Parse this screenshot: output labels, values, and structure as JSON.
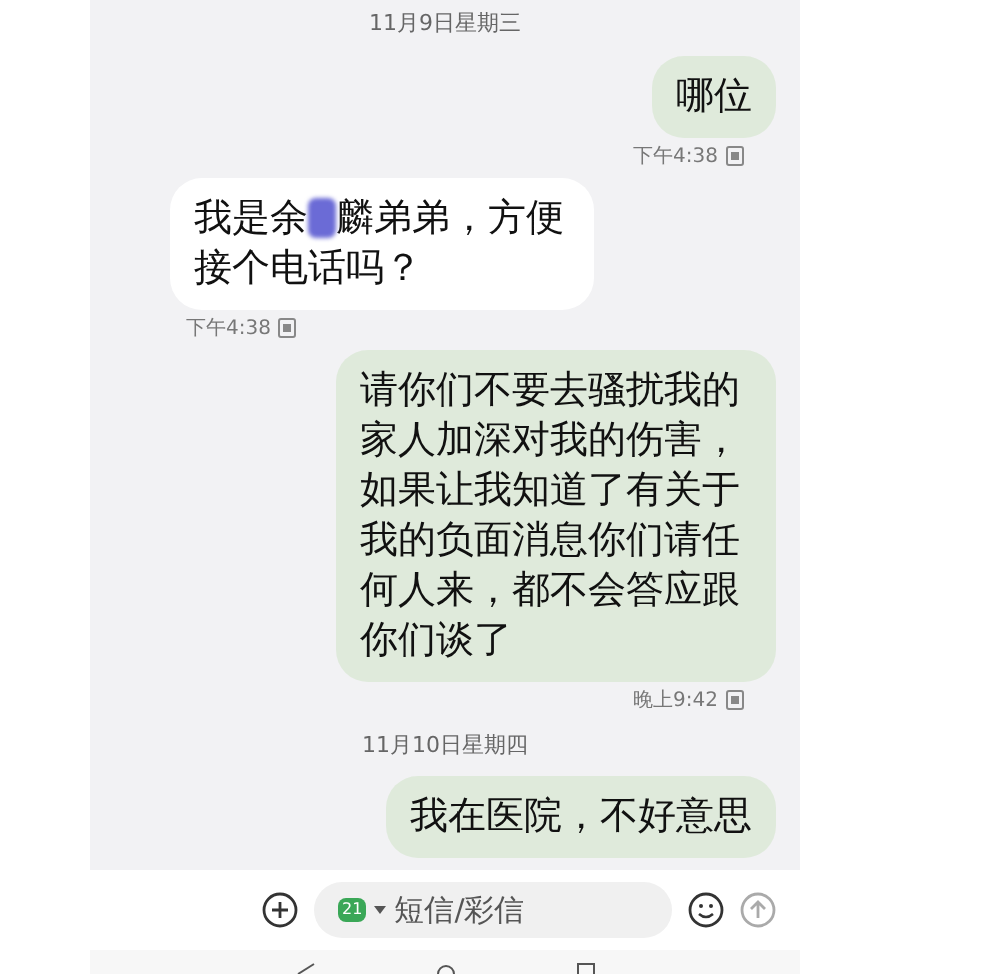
{
  "messages": [
    {
      "kind": "date",
      "text": "11月9日星期三"
    },
    {
      "kind": "out",
      "text": "哪位",
      "time": "下午4:38"
    },
    {
      "kind": "in",
      "text_before": "我是余",
      "redacted": true,
      "text_after": "麟弟弟，方便接个电话吗？",
      "time": "下午4:38"
    },
    {
      "kind": "out",
      "text": "请你们不要去骚扰我的家人加深对我的伤害，如果让我知道了有关于我的负面消息你们请任何人来，都不会答应跟你们谈了",
      "time": "晚上9:42"
    },
    {
      "kind": "date",
      "text": "11月10日星期四"
    },
    {
      "kind": "out",
      "text": "我在医院，不好意思"
    }
  ],
  "composer": {
    "sim": "21",
    "placeholder": "短信/彩信"
  }
}
